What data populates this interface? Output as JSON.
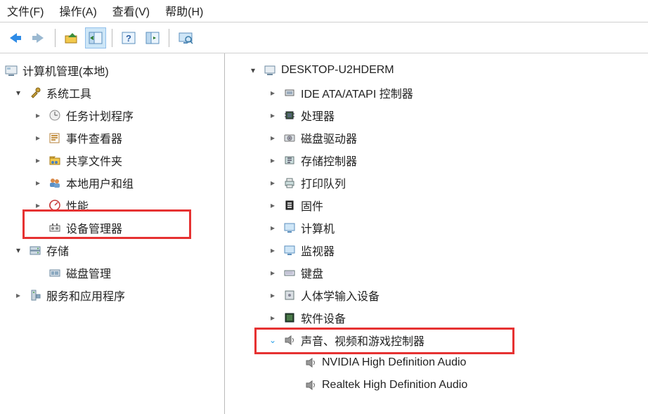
{
  "menu": {
    "file": "文件(F)",
    "action": "操作(A)",
    "view": "查看(V)",
    "help": "帮助(H)"
  },
  "left_tree": {
    "root": "计算机管理(本地)",
    "system_tools": "系统工具",
    "task_scheduler": "任务计划程序",
    "event_viewer": "事件查看器",
    "shared_folders": "共享文件夹",
    "local_users": "本地用户和组",
    "performance": "性能",
    "device_manager": "设备管理器",
    "storage": "存储",
    "disk_management": "磁盘管理",
    "services_apps": "服务和应用程序"
  },
  "right_tree": {
    "computer_name": "DESKTOP-U2HDERM",
    "ide": "IDE ATA/ATAPI 控制器",
    "processors": "处理器",
    "disk_drives": "磁盘驱动器",
    "storage_controllers": "存储控制器",
    "print_queues": "打印队列",
    "firmware": "固件",
    "computer": "计算机",
    "monitors": "监视器",
    "keyboards": "键盘",
    "hid": "人体学输入设备",
    "software_devices": "软件设备",
    "sound": "声音、视频和游戏控制器",
    "nvidia_audio": "NVIDIA High Definition Audio",
    "realtek_audio": "Realtek High Definition Audio"
  },
  "highlight": {
    "left_selected": "device_manager",
    "right_selected": "sound"
  }
}
